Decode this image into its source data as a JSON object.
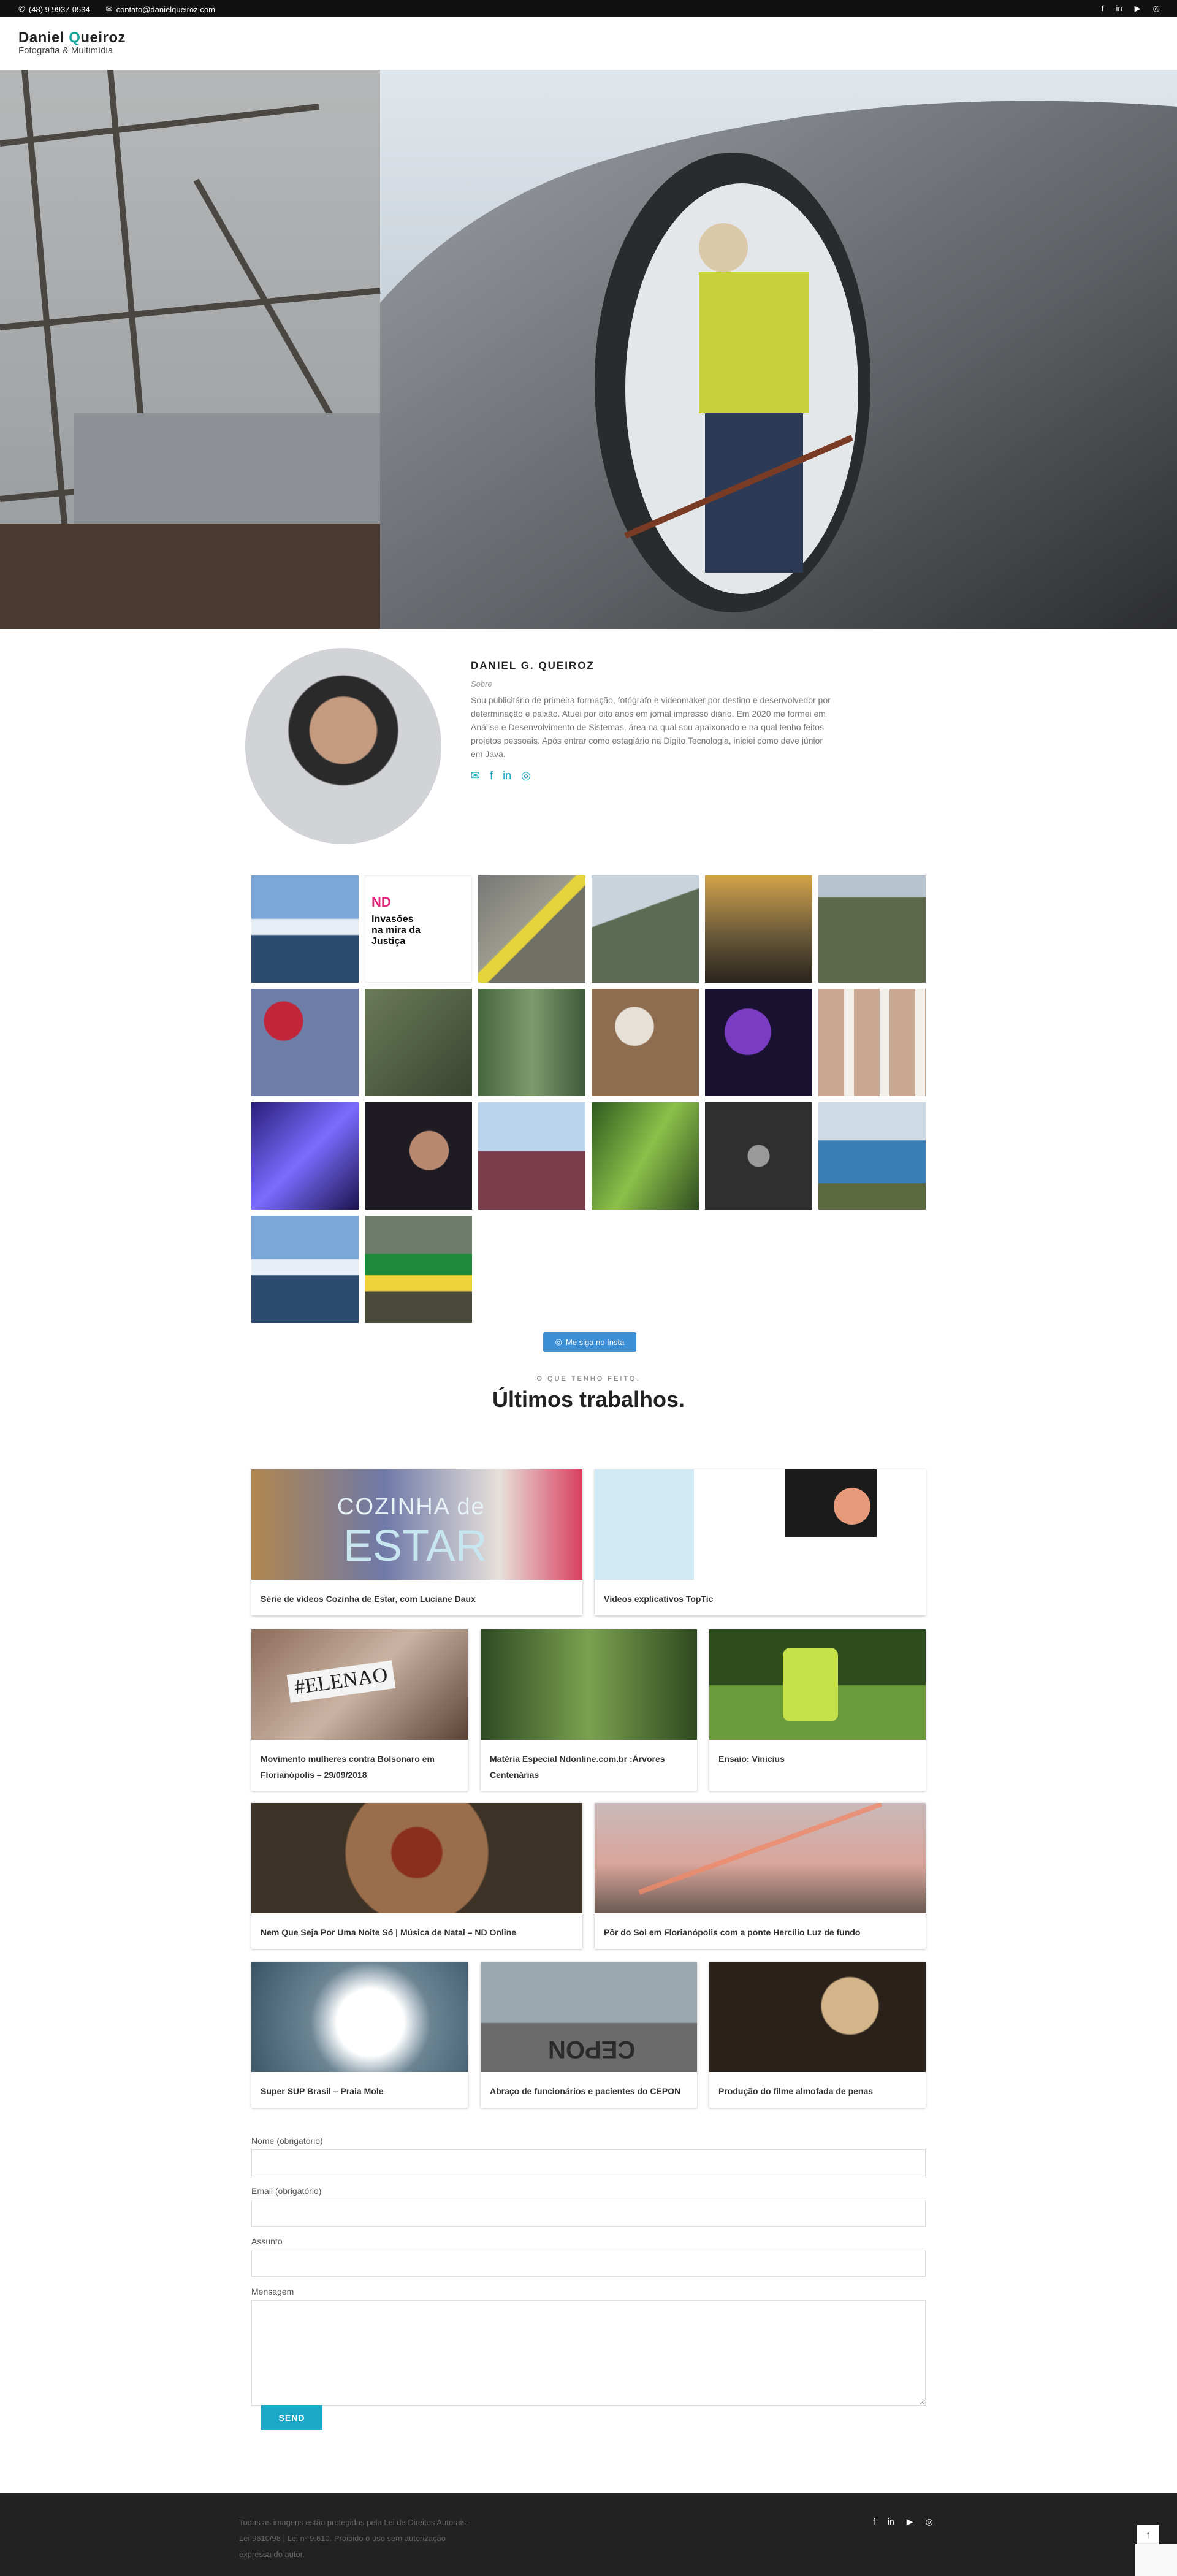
{
  "topbar": {
    "phone": "(48) 9 9937-0534",
    "email": "contato@danielqueiroz.com",
    "social": [
      {
        "icon": "facebook-icon",
        "glyph": "f"
      },
      {
        "icon": "linkedin-icon",
        "glyph": "in"
      },
      {
        "icon": "youtube-icon",
        "glyph": "▶"
      },
      {
        "icon": "instagram-icon",
        "glyph": "◎"
      }
    ]
  },
  "logo": {
    "first": "Daniel",
    "q": "Q",
    "rest": "ueiroz",
    "tagline": "Fotografia & Multimídia"
  },
  "about": {
    "name": "DANIEL G. QUEIROZ",
    "subtitle": "Sobre",
    "text": "Sou publicitário de primeira formação, fotógrafo e videomaker por destino e desenvolvedor por determinação e paixão. Atuei por oito anos em jornal impresso diário. Em 2020 me formei em Análise e Desenvolvimento de Sistemas, área na qual sou apaixonado e na qual tenho feitos projetos pessoais. Após entrar como estagiário na Digito Tecnologia, iniciei como deve júnior em Java.",
    "icons": [
      {
        "name": "email-icon",
        "glyph": "✉"
      },
      {
        "name": "facebook-icon",
        "glyph": "f"
      },
      {
        "name": "linkedin-icon",
        "glyph": "in"
      },
      {
        "name": "instagram-icon",
        "glyph": "◎"
      }
    ]
  },
  "instagram": {
    "button": "Me siga no Insta",
    "post_text": {
      "top": "ND",
      "headline": "Invasões na mira da Justiça"
    }
  },
  "works": {
    "eyebrow": "O QUE TENHO FEITO.",
    "title": "Últimos trabalhos.",
    "cards": [
      {
        "caption": "Série de vídeos Cozinha de Estar, com Luciane Daux",
        "overlay_small": "COZINHA de",
        "overlay_big": "ESTAR"
      },
      {
        "caption": "Vídeos explicativos TopTic"
      },
      {
        "caption": "Movimento mulheres contra Bolsonaro em Florianópolis – 29/09/2018",
        "overlay_big": "#ELENAO"
      },
      {
        "caption": "Matéria Especial Ndonline.com.br :Árvores Centenárias"
      },
      {
        "caption": "Ensaio: Vinicius"
      },
      {
        "caption": "Nem Que Seja Por Uma Noite Só | Música de Natal – ND Online"
      },
      {
        "caption": "Pôr do Sol em Florianópolis com a ponte Hercílio Luz de fundo"
      },
      {
        "caption": "Super SUP Brasil – Praia Mole"
      },
      {
        "caption": "Abraço de funcionários e pacientes do CEPON",
        "overlay_big": "CEPON"
      },
      {
        "caption": "Produção do filme almofada de penas"
      }
    ]
  },
  "form": {
    "name_label": "Nome (obrigatório)",
    "email_label": "Email (obrigatório)",
    "subject_label": "Assunto",
    "message_label": "Mensagem",
    "send": "SEND"
  },
  "footer": {
    "copyright": "Todas as imagens estão protegidas pela Lei de Direitos Autorais - Lei 9610/98 | Lei nº 9.610. Proibido o uso sem autorização expressa do autor.",
    "to_top": "↑"
  }
}
